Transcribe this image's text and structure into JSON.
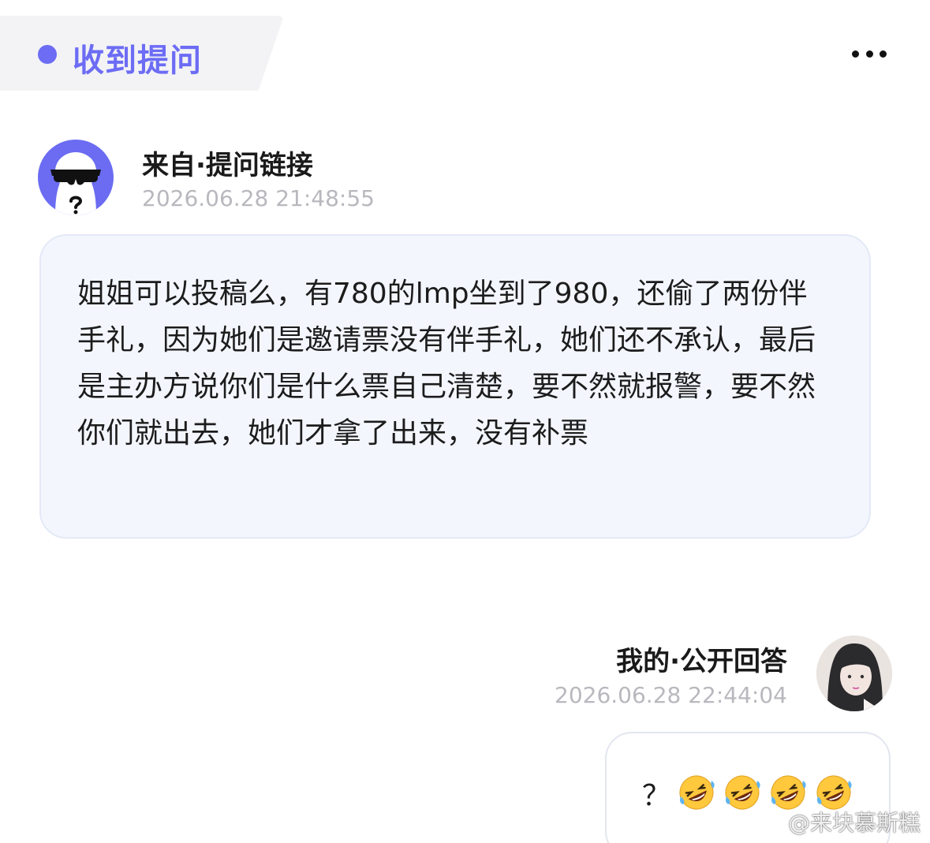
{
  "header": {
    "title": "收到提问",
    "accent_color": "#6c6cf5",
    "more_icon": "more-horizontal-icon"
  },
  "question": {
    "from_label": "来自·提问链接",
    "timestamp": "2026.06.28 21:48:55",
    "text": "姐姐可以投稿么，有780的lmp坐到了980，还偷了两份伴手礼，因为她们是邀请票没有伴手礼，她们还不承认，最后是主办方说你们是什么票自己清楚，要不然就报警，要不然你们就出去，她们才拿了出来，没有补票",
    "avatar_icon": "anonymous-sunglasses-avatar"
  },
  "answer": {
    "label": "我的·公开回答",
    "timestamp": "2026.06.28 22:44:04",
    "text": "？",
    "emoji": [
      "rolling-on-floor-laughing",
      "rolling-on-floor-laughing",
      "rolling-on-floor-laughing",
      "rolling-on-floor-laughing"
    ]
  },
  "watermark": {
    "text": "@来块慕斯糕",
    "icon": "weibo-icon"
  }
}
